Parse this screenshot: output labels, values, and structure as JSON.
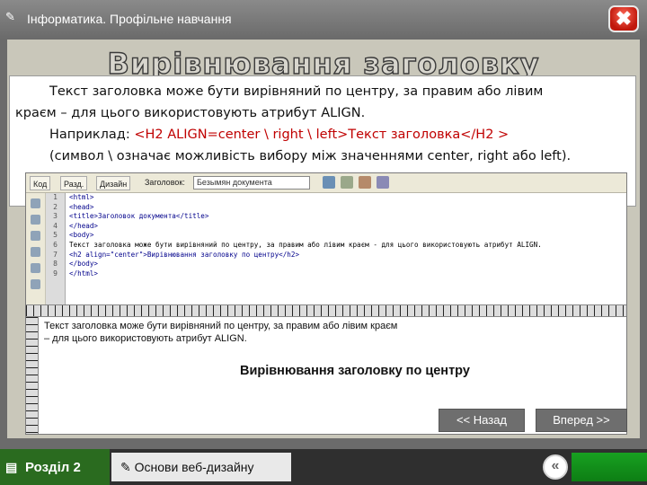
{
  "window": {
    "title": "Інформатика. Профільне навчання",
    "close_glyph": "✖"
  },
  "slide": {
    "title": "Вирівнювання заголовку",
    "para1_line1": "Текст  заголовка може бути вирівняний по центру, за правим або лівим",
    "para1_line2": "краєм – для цього використовують атрибут ALIGN.",
    "para2_prefix": "Наприклад: ",
    "para2_code": "<H2 ALIGN=center \\ right \\ left>Текст заголовка</H2 >",
    "para3": "(символ \\ означає можливість вибору між значеннями center, right або left)."
  },
  "editor": {
    "toolbar": {
      "code_view": "Код",
      "split_view": "Разд.",
      "design_view": "Дизайн",
      "title_label": "Заголовок:",
      "title_value": "Безымян документа"
    },
    "line_numbers": [
      "1",
      "2",
      "3",
      "4",
      "5",
      "6",
      "7",
      "8",
      "9"
    ],
    "code_lines": [
      "<html>",
      "<head>",
      "<title>Заголовок документа</title>",
      "</head>",
      "<body>",
      "Текст  заголовка може бути вирівняний по центру, за правим або лівим краєм - для цього використовують атрибут ALIGN.",
      "<h2 align=\"center\">Вирівнювання заголовку по центру</h2>",
      "</body>",
      "</html>"
    ],
    "preview": {
      "line1": "Текст заголовка може бути вирівняний по центру, за правим або лівим краєм",
      "line2": "– для цього використовують атрибут ALIGN.",
      "heading": "Вирівнювання заголовку по центру"
    }
  },
  "navigation": {
    "back_label": "<< Назад",
    "forward_label": "Вперед >>"
  },
  "footer": {
    "section_label": "Розділ 2",
    "course_label": "Основи веб-дизайну"
  },
  "colors": {
    "accent_green": "#2a6b1f",
    "code_red": "#c00000",
    "close_red": "#c0180c"
  }
}
